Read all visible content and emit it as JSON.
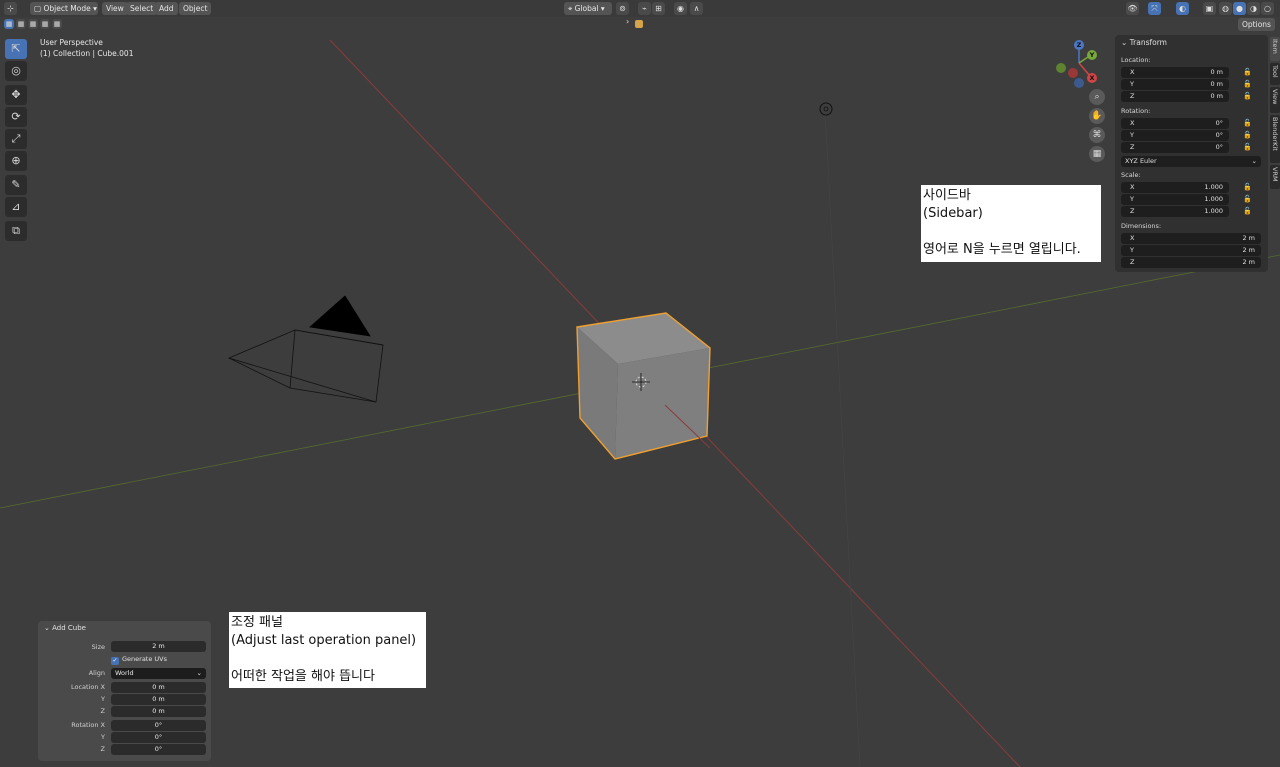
{
  "header": {
    "mode_label": "Object Mode",
    "menus": [
      "View",
      "Select",
      "Add",
      "Object"
    ],
    "transform_orientation": "Global",
    "options_label": "Options"
  },
  "viewport": {
    "perspective_label": "User Perspective",
    "collection_label": "(1) Collection | Cube.001"
  },
  "gizmo": {
    "x": "X",
    "y": "Y",
    "z": "Z"
  },
  "sidebar": {
    "panel_title": "Transform",
    "location_label": "Location:",
    "location": [
      {
        "axis": "X",
        "value": "0 m"
      },
      {
        "axis": "Y",
        "value": "0 m"
      },
      {
        "axis": "Z",
        "value": "0 m"
      }
    ],
    "rotation_label": "Rotation:",
    "rotation": [
      {
        "axis": "X",
        "value": "0°"
      },
      {
        "axis": "Y",
        "value": "0°"
      },
      {
        "axis": "Z",
        "value": "0°"
      }
    ],
    "rotation_mode": "XYZ Euler",
    "scale_label": "Scale:",
    "scale": [
      {
        "axis": "X",
        "value": "1.000"
      },
      {
        "axis": "Y",
        "value": "1.000"
      },
      {
        "axis": "Z",
        "value": "1.000"
      }
    ],
    "dimensions_label": "Dimensions:",
    "dimensions": [
      {
        "axis": "X",
        "value": "2 m"
      },
      {
        "axis": "Y",
        "value": "2 m"
      },
      {
        "axis": "Z",
        "value": "2 m"
      }
    ],
    "tabs": [
      "Item",
      "Tool",
      "View",
      "BlenderKit",
      "VRM"
    ]
  },
  "annotations": {
    "sidebar_note": [
      "사이드바",
      "(Sidebar)",
      "",
      "영어로 N을 누르면 열립니다."
    ],
    "adjust_note": [
      "조정 패널",
      "(Adjust last operation panel)",
      "",
      "어떠한 작업을 해야 뜹니다"
    ]
  },
  "adjust_panel": {
    "title": "Add Cube",
    "size_label": "Size",
    "size_value": "2 m",
    "generate_uvs_label": "Generate UVs",
    "generate_uvs_checked": true,
    "align_label": "Align",
    "align_value": "World",
    "location_label": "Location X",
    "location": [
      "0 m",
      "0 m",
      "0 m"
    ],
    "rotation_label": "Rotation X",
    "rotation": [
      "0°",
      "0°",
      "0°"
    ],
    "y_label": "Y",
    "z_label": "Z"
  },
  "colors": {
    "accent_blue": "#4772b3",
    "selection_orange": "#f0a030",
    "x_axis_red": "#9b3a3a",
    "y_axis_green": "#5b7a2e"
  }
}
